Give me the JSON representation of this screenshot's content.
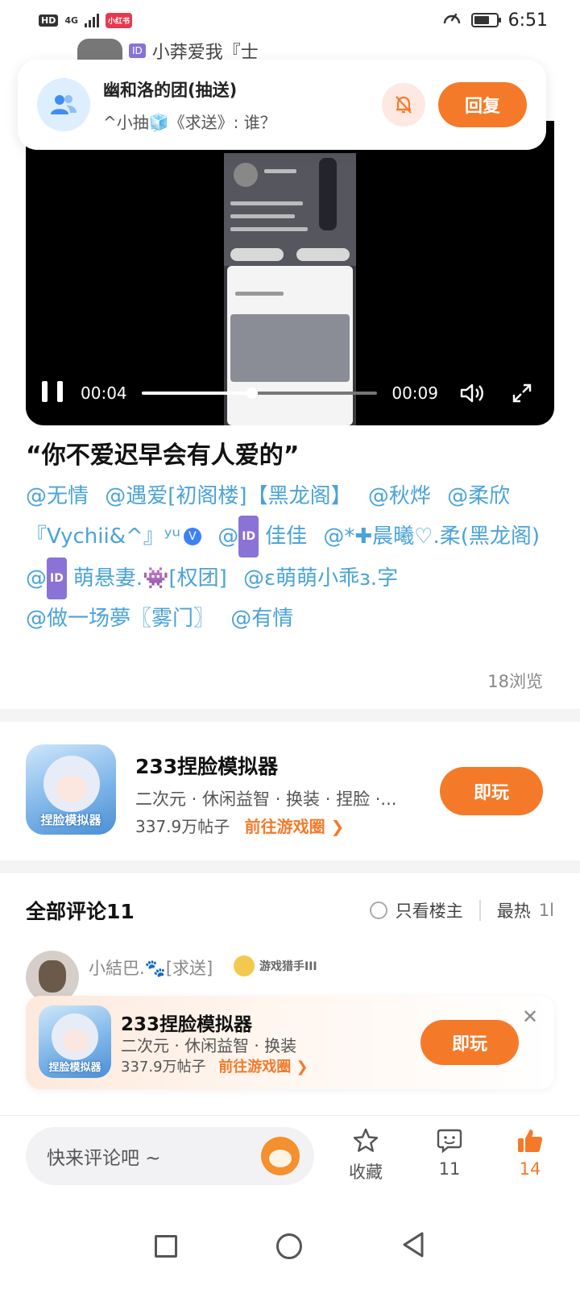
{
  "status_bar": {
    "network_label": "HD",
    "signal_label": "4G",
    "app_badge": "小红书",
    "time": "6:51"
  },
  "background_peek": {
    "id_badge": "ID",
    "text": "小莽爱我『士"
  },
  "notification": {
    "title": "幽和洛的团(抽送)",
    "message": "^小抽🧊《求送》: 谁？",
    "reply_label": "回复"
  },
  "video": {
    "current_time": "00:04",
    "duration": "00:09",
    "progress": 0.47
  },
  "post": {
    "title": "“你不爱迟早会有人爱的”",
    "mentions": [
      {
        "text": "@无情"
      },
      {
        "text": "@遇爱[初阁楼]【黑龙阁】"
      },
      {
        "text": "@秋烨"
      },
      {
        "text": "@柔欣"
      },
      {
        "text": "『Vychii&^』ʸᵘ",
        "verified": "V"
      },
      {
        "text": "佳佳",
        "prefix": "@",
        "id_badge": "ID"
      },
      {
        "text": "@*✚晨曦♡.柔(黑龙阁)"
      },
      {
        "text": "萌悬妻.👾[权团]",
        "prefix": "@",
        "id_badge": "ID"
      },
      {
        "text": "@ɛ萌萌小乖ɜ.字"
      },
      {
        "text": "@做一场夢〖雾门〗"
      },
      {
        "text": "@有情"
      }
    ],
    "views": "18浏览"
  },
  "game_card": {
    "name": "233捏脸模拟器",
    "tags": "二次元 · 休闲益智 · 换装 · 捏脸 ·...",
    "posts": "337.9万帖子",
    "link": "前往游戏圈 ❯",
    "play_label": "即玩",
    "icon_label": "捏脸模拟器"
  },
  "comments": {
    "title": "全部评论11",
    "only_owner": "只看楼主",
    "sort_hot": "最热",
    "sort_clip": "1l",
    "first_comment": {
      "user": "小結巴.🐾[求送]",
      "level_label": "游戏猎手III"
    }
  },
  "banner": {
    "name": "233捏脸模拟器",
    "tags": "二次元 · 休闲益智 · 换装",
    "posts": "337.9万帖子",
    "link": "前往游戏圈 ❯",
    "play_label": "即玩",
    "icon_label": "捏脸模拟器",
    "close": "✕"
  },
  "bottom_bar": {
    "input_placeholder": "快来评论吧 ~",
    "favorite_label": "收藏",
    "comment_count": "11",
    "like_count": "14"
  },
  "colors": {
    "accent": "#f47a2a",
    "mention": "#4aa3d8",
    "id_badge": "#8a73d6"
  }
}
